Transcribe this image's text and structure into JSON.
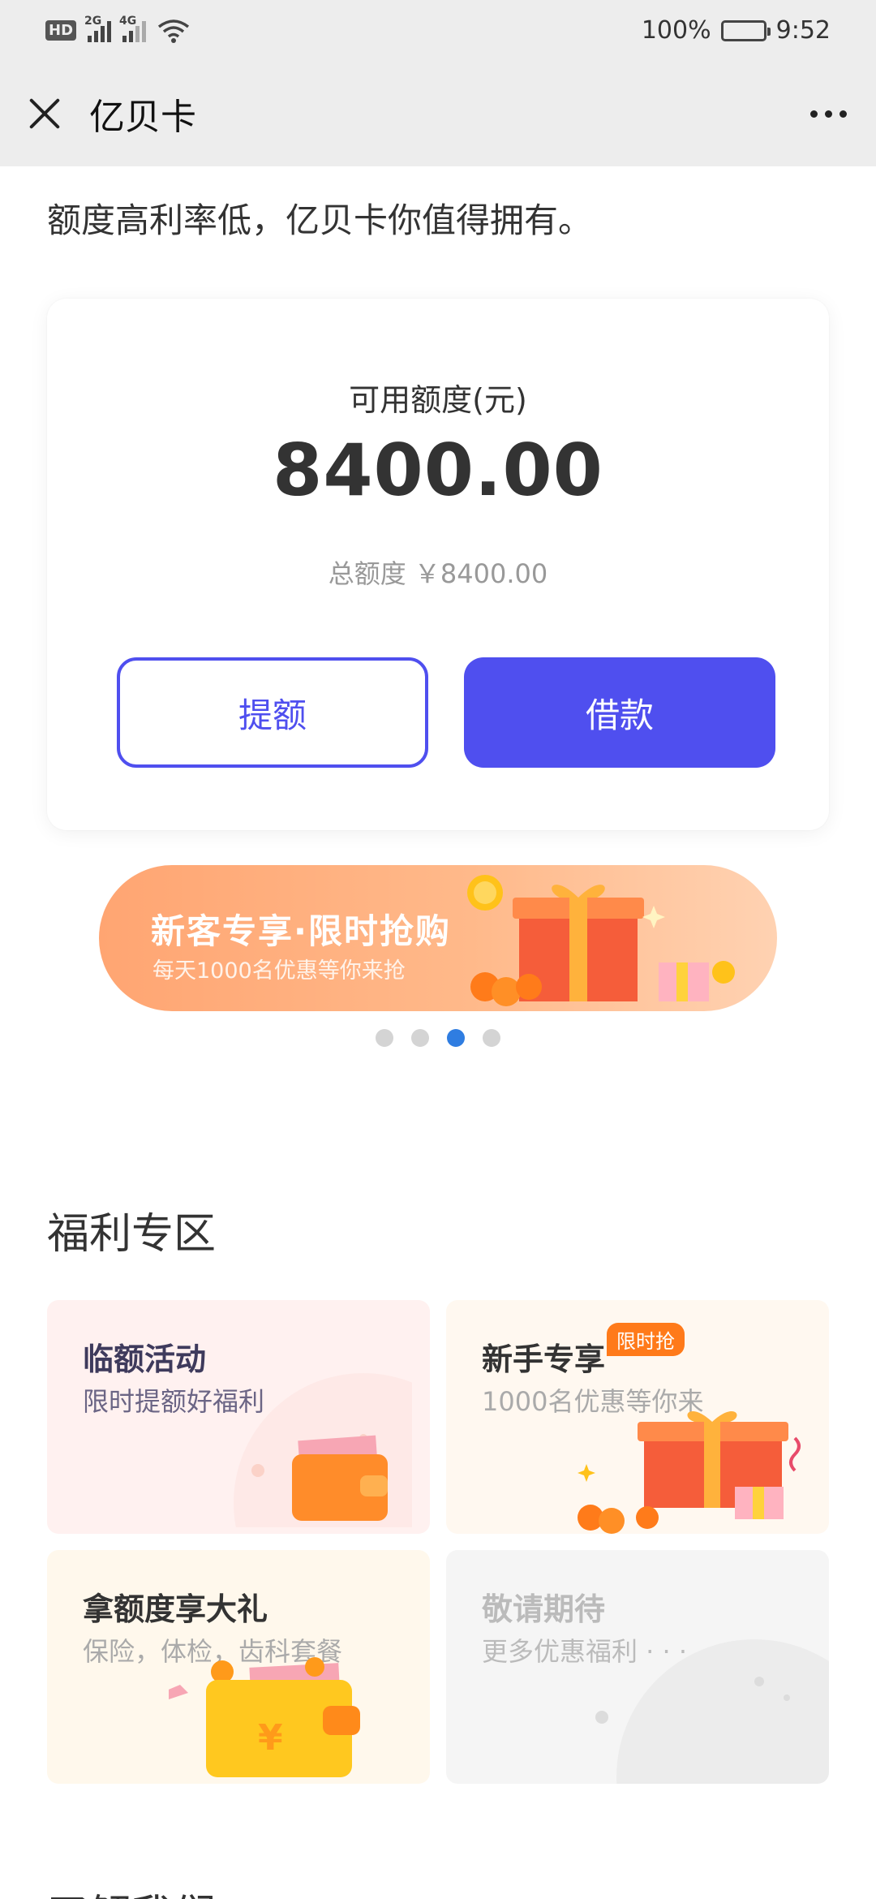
{
  "status_bar": {
    "hd": "HD",
    "net1": "2G",
    "net2": "4G",
    "battery": "100%",
    "time": "9:52"
  },
  "nav": {
    "title": "亿贝卡"
  },
  "tagline": "额度高利率低，亿贝卡你值得拥有。",
  "credit": {
    "available_label": "可用额度(元)",
    "available_amount": "8400.00",
    "total_label": "总额度 ￥8400.00",
    "raise_button": "提额",
    "borrow_button": "借款"
  },
  "banner": {
    "title": "新客专享·限时抢购",
    "subtitle": "每天1000名优惠等你来抢",
    "pager_total": 4,
    "pager_active": 3
  },
  "welfare": {
    "section_title": "福利专区",
    "tiles": [
      {
        "title": "临额活动",
        "subtitle": "限时提额好福利"
      },
      {
        "title": "新手专享",
        "subtitle": "1000名优惠等你来",
        "badge": "限时抢"
      },
      {
        "title": "拿额度享大礼",
        "subtitle": "保险，体检，齿科套餐"
      },
      {
        "title": "敬请期待",
        "subtitle": "更多优惠福利 · · ·"
      }
    ]
  },
  "about": {
    "section_title": "了解我们"
  },
  "colors": {
    "primary": "#4f4fef",
    "banner_orange": "#ffa572",
    "pager_active": "#2f7de1"
  }
}
